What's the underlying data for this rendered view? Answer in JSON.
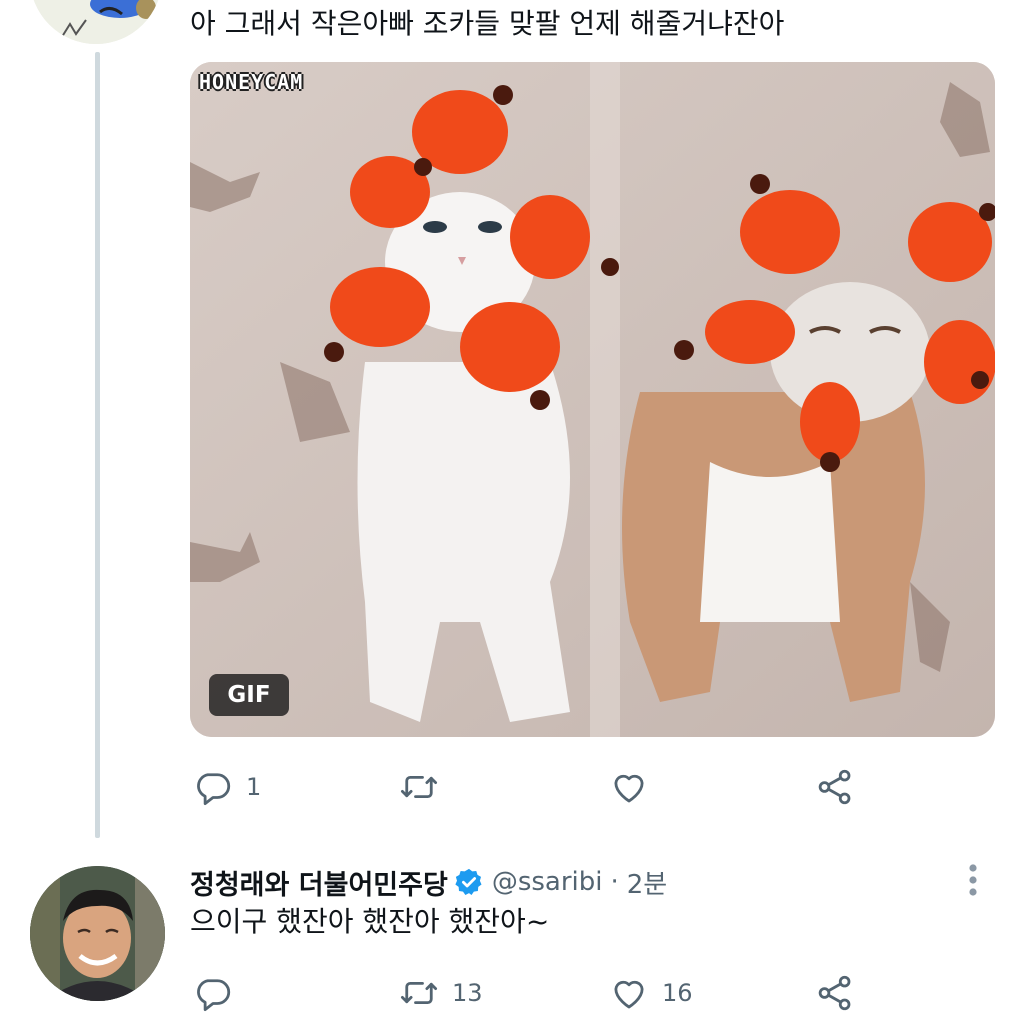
{
  "tweet1": {
    "text": "아 그래서 작은아빠 조카들 맞팔 언제 해줄거냐잔아",
    "media": {
      "watermark": "HONEYCAM",
      "badge": "GIF",
      "description_colors": {
        "hat": "#f04a1a",
        "background": "#cdbfb8"
      }
    },
    "actions": {
      "reply_icon": "reply-icon",
      "reply_count": "1",
      "retweet_icon": "retweet-icon",
      "retweet_count": "",
      "like_icon": "heart-icon",
      "like_count": "",
      "share_icon": "share-icon"
    }
  },
  "tweet2": {
    "display_name": "정청래와 더불어민주당",
    "verified_icon": "verified-badge-icon",
    "handle": "@ssaribi",
    "separator": "·",
    "time": "2분",
    "text": "으이구 했잔아 했잔아 했잔아~",
    "actions": {
      "reply_count": "",
      "retweet_count": "13",
      "like_count": "16"
    }
  },
  "colors": {
    "text": "#0f1419",
    "secondary": "#536471",
    "thread_line": "#cfd9de",
    "verified": "#1d9bf0"
  }
}
